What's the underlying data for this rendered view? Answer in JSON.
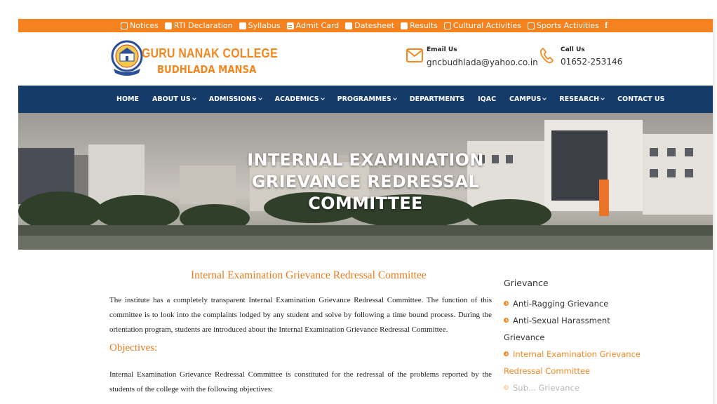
{
  "topbar": {
    "links": [
      {
        "label": "Notices",
        "icon": "document-icon"
      },
      {
        "label": "RTI Declaration",
        "icon": "list-icon"
      },
      {
        "label": "Syllabus",
        "icon": "list-icon"
      },
      {
        "label": "Admit Card",
        "icon": "id-card-icon"
      },
      {
        "label": "Datesheet",
        "icon": "list-icon"
      },
      {
        "label": "Results",
        "icon": "list-icon"
      },
      {
        "label": "Cultural Activities",
        "icon": "document-icon"
      },
      {
        "label": "Sports Activities",
        "icon": "document-icon"
      }
    ],
    "facebook": "f",
    "color": "#f6821f"
  },
  "header": {
    "college_name": "GURU NANAK COLLEGE",
    "college_sub": "BUDHLADA MANSA",
    "email_label": "Email Us",
    "email_value": "gncbudhlada@yahoo.co.in",
    "call_label": "Call Us",
    "call_value": "01652-253146",
    "accent": "#f48720"
  },
  "nav": {
    "color": "#153b6b",
    "items": [
      {
        "label": "HOME",
        "dropdown": false
      },
      {
        "label": "ABOUT US",
        "dropdown": true
      },
      {
        "label": "ADMISSIONS",
        "dropdown": true
      },
      {
        "label": "ACADEMICS",
        "dropdown": true
      },
      {
        "label": "PROGRAMMES",
        "dropdown": true
      },
      {
        "label": "DEPARTMENTS",
        "dropdown": false
      },
      {
        "label": "IQAC",
        "dropdown": false
      },
      {
        "label": "CAMPUS",
        "dropdown": true
      },
      {
        "label": "RESEARCH",
        "dropdown": true
      },
      {
        "label": "CONTACT US",
        "dropdown": false
      }
    ]
  },
  "hero": {
    "title_lines": [
      "INTERNAL EXAMINATION",
      "GRIEVANCE REDRESSAL",
      "COMMITTEE"
    ]
  },
  "content": {
    "title": "Internal Examination Grievance Redressal Committee",
    "intro": "The institute has a completely transparent Internal Examination Grievance Redressal Committee. The function of this committee is to look into the complaints lodged by any student and solve by following a time bound process. During the orientation program, students are introduced about the Internal Examination Grievance Redressal Committee.",
    "objectives_heading": "Objectives:",
    "objectives_intro": "Internal Examination Grievance Redressal Committee is constituted for the redressal of the problems reported by the students of the college with the following objectives:"
  },
  "sidebar": {
    "heading": "Grievance",
    "items": [
      {
        "label": "Anti-Ragging Grievance",
        "active": false
      },
      {
        "label": "Anti-Sexual Harassment Grievance",
        "active": false
      },
      {
        "label": "Internal Examination Grievance Redressal Committee",
        "active": true
      },
      {
        "label": "Sub... Grievance",
        "active": false
      }
    ]
  }
}
